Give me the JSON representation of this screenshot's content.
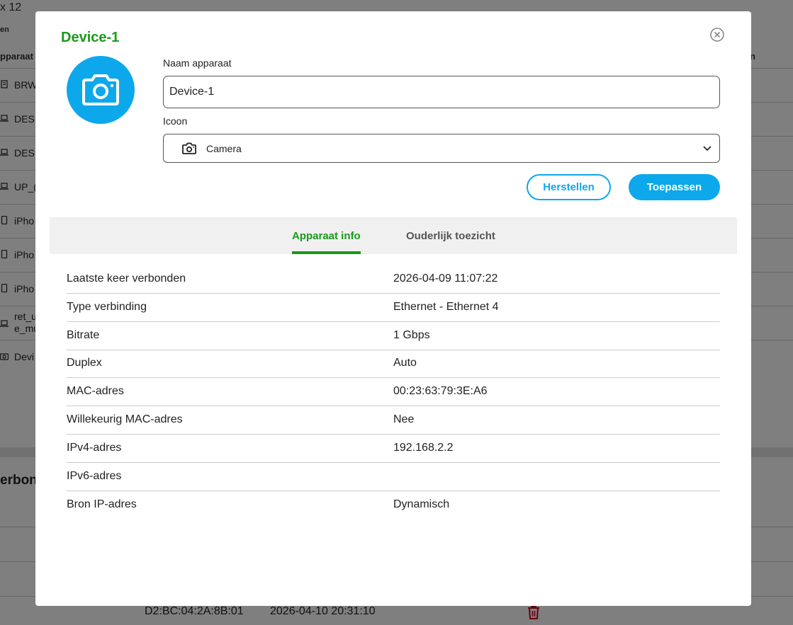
{
  "background": {
    "title_fragment": "x 12",
    "subtitle_fragment": "en",
    "column_fragment": "pparaat",
    "column_right_fragment": "n",
    "rows": [
      {
        "icon": "printer-icon",
        "label": "BRW"
      },
      {
        "icon": "laptop-icon",
        "label": "DES"
      },
      {
        "icon": "laptop-icon",
        "label": "DES"
      },
      {
        "icon": "laptop-icon",
        "label": "UP_("
      },
      {
        "icon": "phone-icon",
        "label": "iPho"
      },
      {
        "icon": "phone-icon",
        "label": "iPho"
      },
      {
        "icon": "phone-icon",
        "label": "iPho"
      },
      {
        "icon": "laptop-icon",
        "label": "ret_u\ne_mu"
      },
      {
        "icon": "camera-icon",
        "label": "Devi"
      }
    ],
    "section_fragment": "erbon",
    "bottom_mac": "D2:BC:04:2A:8B:01",
    "bottom_date": "2026-04-10 20:31:10"
  },
  "modal": {
    "title": "Device-1",
    "avatar_icon": "camera-icon",
    "name_label": "Naam apparaat",
    "name_value": "Device-1",
    "icon_label": "Icoon",
    "icon_select": {
      "icon": "camera-icon",
      "value": "Camera"
    },
    "reset_label": "Herstellen",
    "apply_label": "Toepassen",
    "tabs": [
      {
        "label": "Apparaat info",
        "active": true
      },
      {
        "label": "Ouderlijk toezicht",
        "active": false
      }
    ],
    "info": [
      {
        "key": "Laatste keer verbonden",
        "value": "2026-04-09 11:07:22"
      },
      {
        "key": "Type verbinding",
        "value": "Ethernet - Ethernet 4"
      },
      {
        "key": "Bitrate",
        "value": "1 Gbps"
      },
      {
        "key": "Duplex",
        "value": "Auto"
      },
      {
        "key": "MAC-adres",
        "value": "00:23:63:79:3E:A6"
      },
      {
        "key": "Willekeurig MAC-adres",
        "value": "Nee"
      },
      {
        "key": "IPv4-adres",
        "value": "192.168.2.2"
      },
      {
        "key": "IPv6-adres",
        "value": ""
      },
      {
        "key": "Bron IP-adres",
        "value": "Dynamisch"
      }
    ]
  },
  "colors": {
    "accent_blue": "#0da8ec",
    "title_green": "#1a9a1a",
    "danger_red": "#d0021b"
  }
}
